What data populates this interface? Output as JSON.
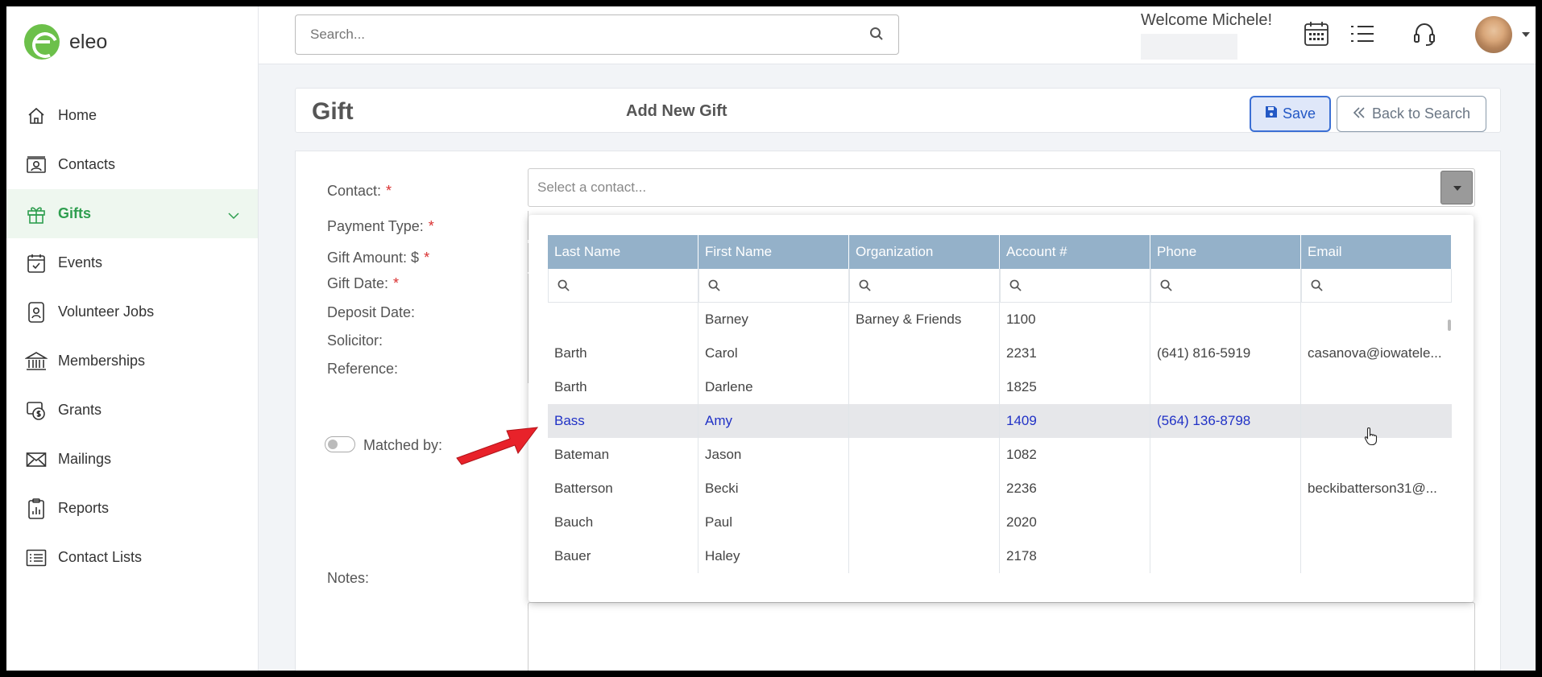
{
  "app": {
    "name": "eleo"
  },
  "sidebar": {
    "items": [
      {
        "label": "Home",
        "icon": "home-icon"
      },
      {
        "label": "Contacts",
        "icon": "contacts-icon"
      },
      {
        "label": "Gifts",
        "icon": "gift-icon",
        "active": true
      },
      {
        "label": "Events",
        "icon": "calendar-check-icon"
      },
      {
        "label": "Volunteer Jobs",
        "icon": "badge-icon"
      },
      {
        "label": "Memberships",
        "icon": "institution-icon"
      },
      {
        "label": "Grants",
        "icon": "money-icon"
      },
      {
        "label": "Mailings",
        "icon": "envelope-icon"
      },
      {
        "label": "Reports",
        "icon": "report-icon"
      },
      {
        "label": "Contact Lists",
        "icon": "list-icon"
      }
    ]
  },
  "topbar": {
    "search_placeholder": "Search...",
    "welcome": "Welcome Michele!"
  },
  "header": {
    "title": "Gift",
    "subtitle": "Add New Gift",
    "save_label": "Save",
    "back_label": "Back to Search"
  },
  "form": {
    "labels": {
      "contact": "Contact:",
      "payment_type": "Payment Type:",
      "gift_amount": "Gift Amount: $",
      "gift_date": "Gift Date:",
      "deposit_date": "Deposit Date:",
      "solicitor": "Solicitor:",
      "reference": "Reference:",
      "matched_by": "Matched by:",
      "notes": "Notes:"
    },
    "required_mark": "*",
    "contact_placeholder": "Select a contact..."
  },
  "contact_grid": {
    "columns": [
      "Last Name",
      "First Name",
      "Organization",
      "Account #",
      "Phone",
      "Email"
    ],
    "rows": [
      [
        "",
        "Barney",
        "Barney & Friends",
        "1100",
        "",
        ""
      ],
      [
        "Barth",
        "Carol",
        "",
        "2231",
        "(641) 816-5919",
        "casanova@iowatele..."
      ],
      [
        "Barth",
        "Darlene",
        "",
        "1825",
        "",
        ""
      ],
      [
        "Bass",
        "Amy",
        "",
        "1409",
        "(564) 136-8798",
        ""
      ],
      [
        "Bateman",
        "Jason",
        "",
        "1082",
        "",
        ""
      ],
      [
        "Batterson",
        "Becki",
        "",
        "2236",
        "",
        "beckibatterson31@..."
      ],
      [
        "Bauch",
        "Paul",
        "",
        "2020",
        "",
        ""
      ],
      [
        "Bauer",
        "Haley",
        "",
        "2178",
        "",
        ""
      ]
    ],
    "highlighted_row": 3
  }
}
